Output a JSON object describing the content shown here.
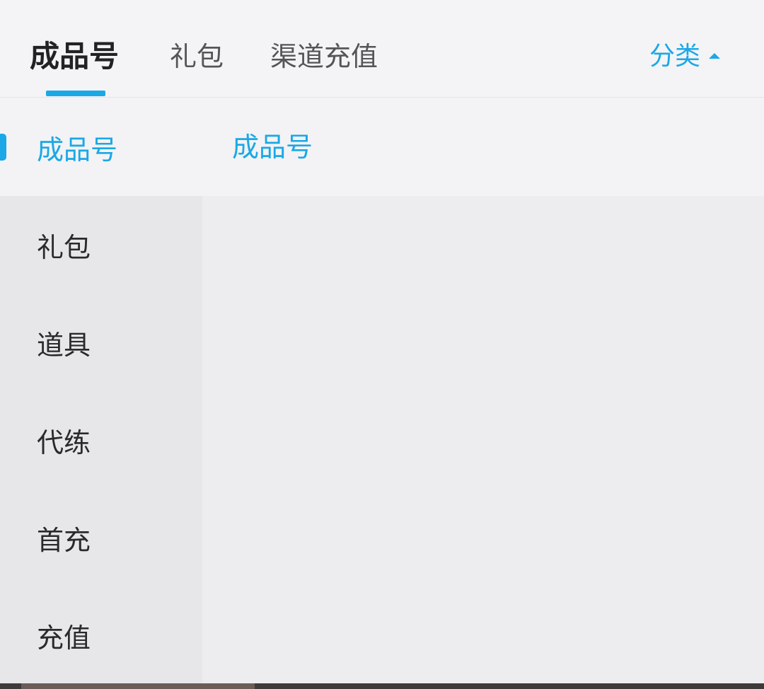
{
  "tabs": [
    {
      "label": "成品号",
      "active": true
    },
    {
      "label": "礼包",
      "active": false
    },
    {
      "label": "渠道充值",
      "active": false
    }
  ],
  "category_toggle": {
    "label": "分类",
    "icon": "caret-up-icon"
  },
  "sidebar": {
    "items": [
      {
        "label": "成品号",
        "active": true
      },
      {
        "label": "礼包",
        "active": false
      },
      {
        "label": "道具",
        "active": false
      },
      {
        "label": "代练",
        "active": false
      },
      {
        "label": "首充",
        "active": false
      },
      {
        "label": "充值",
        "active": false
      }
    ]
  },
  "content": {
    "title": "成品号"
  },
  "colors": {
    "accent": "#1ba8e6",
    "text": "#2a2a2d",
    "sidebar_bg": "#e7e7ea",
    "panel_bg": "#f3f3f5"
  }
}
